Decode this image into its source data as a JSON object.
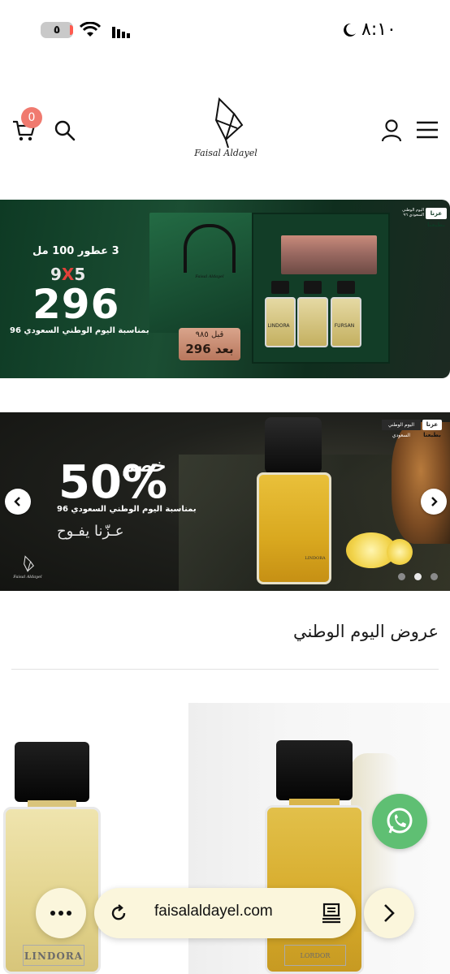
{
  "status_bar": {
    "time": "٨:١٠",
    "battery": "٥",
    "icons": [
      "wifi-icon",
      "signal-icon",
      "moon-icon"
    ]
  },
  "header": {
    "logo_text": "Faisal Aldayel",
    "cart_count": "0",
    "icons": [
      "cart-icon",
      "search-icon",
      "user-icon",
      "menu-icon"
    ]
  },
  "banner1": {
    "headline": "3 عطور 100 مل",
    "old_price_before": "9",
    "old_price_x": "X",
    "old_price_after": "5",
    "new_price": "296",
    "note": "بمناسبة اليوم الوطني السعودي 96",
    "plaque_before": "قبل ٩٨٥",
    "plaque_after": "بعد 296",
    "bottle_labels": [
      "LINDORA",
      "FURSAN"
    ],
    "bag_logo": "Faisal Aldayel",
    "tag_pill": "عزنا بطبعنا",
    "tag_small": "اليوم الوطني السعودي ٩٦",
    "colors": {
      "bg": "#1b4e33",
      "accent": "#e0413a"
    }
  },
  "banner2": {
    "khasm": "خصم",
    "percent": "50%",
    "note": "بمناسبة اليوم الوطني السعودي 96",
    "slogan": "عـزّنا يفـوح",
    "logo_text": "Faisal Aldayel",
    "bottle_label": "LINDORA",
    "tag_pill": "عزنا بطبعنا",
    "tag_dark": "اليوم الوطني السعودي",
    "slides_total": 3,
    "slide_active": 2
  },
  "section": {
    "title": "عروض اليوم الوطني"
  },
  "products": [
    {
      "label": "LINDORA"
    },
    {
      "label": "LORDOR"
    }
  ],
  "browser": {
    "url": "faisalaldayel.com",
    "icons": [
      "more-icon",
      "reload-icon",
      "tabs-icon",
      "forward-icon"
    ]
  },
  "floating": {
    "whatsapp": "whatsapp-icon",
    "color": "#5fbf73"
  }
}
